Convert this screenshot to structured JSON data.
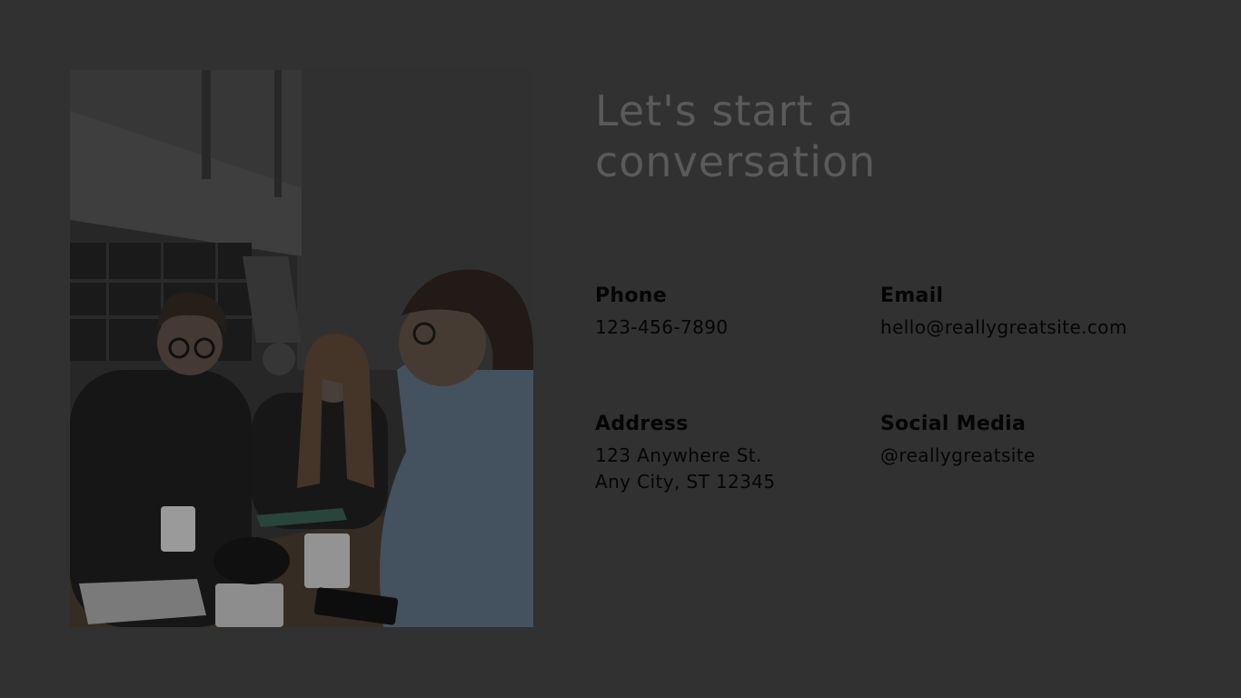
{
  "title": {
    "line1": "Let's start a",
    "line2": "conversation"
  },
  "contact": {
    "phone": {
      "label": "Phone",
      "value": "123-456-7890"
    },
    "email": {
      "label": "Email",
      "value": "hello@reallygreatsite.com"
    },
    "address": {
      "label": "Address",
      "line1": "123 Anywhere St.",
      "line2": "Any City, ST 12345"
    },
    "social": {
      "label": "Social Media",
      "value": "@reallygreatsite"
    }
  },
  "colors": {
    "background": "#313131",
    "title": "#5a5a5a",
    "text": "#050505"
  }
}
